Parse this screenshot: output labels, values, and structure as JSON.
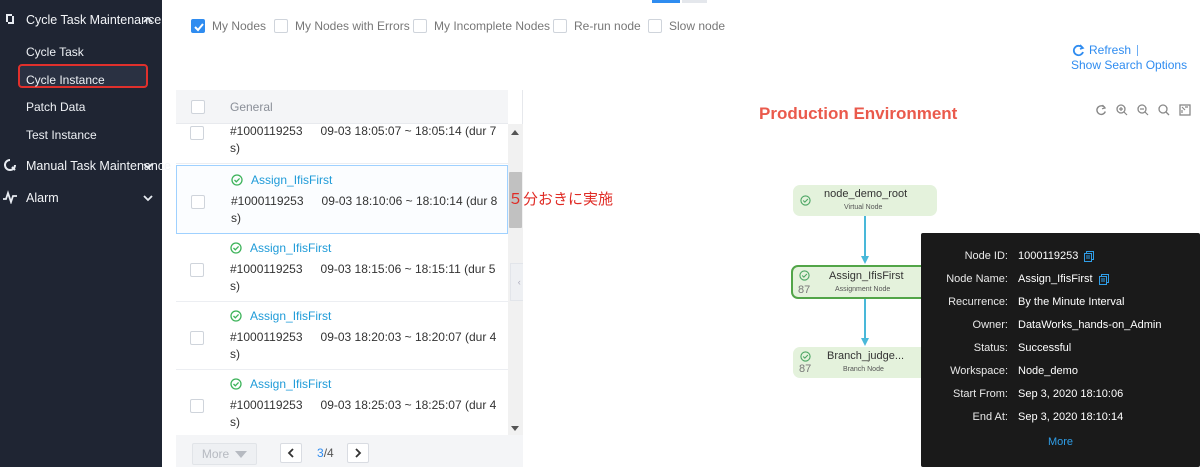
{
  "sidebar": {
    "groups": [
      {
        "label": "Cycle Task Maintenance",
        "icon": "task-cycle-icon"
      },
      {
        "label": "Manual Task Maintenance",
        "icon": "refresh-circle-icon"
      },
      {
        "label": "Alarm",
        "icon": "pulse-icon"
      }
    ],
    "items": [
      "Cycle Task",
      "Cycle Instance",
      "Patch Data",
      "Test Instance"
    ],
    "active": "Cycle Instance"
  },
  "filters": [
    {
      "label": "My Nodes",
      "checked": true
    },
    {
      "label": "My Nodes with Errors",
      "checked": false
    },
    {
      "label": "My Incomplete Nodes",
      "checked": false
    },
    {
      "label": "Re-run node",
      "checked": false
    },
    {
      "label": "Slow node",
      "checked": false
    }
  ],
  "toolbar": {
    "refresh_label": "Refresh",
    "search_options_label": "Show Search Options",
    "accent": "#2f8cf0"
  },
  "list": {
    "header": "General",
    "rows": [
      {
        "name": "",
        "id": "#1000119253",
        "time": "09-03 18:05:07 ~ 18:05:14 (dur 7",
        "tail": "s)"
      },
      {
        "name": "Assign_IfisFirst",
        "id": "#1000119253",
        "time": "09-03 18:10:06 ~ 18:10:14 (dur 8",
        "tail": "s)"
      },
      {
        "name": "Assign_IfisFirst",
        "id": "#1000119253",
        "time": "09-03 18:15:06 ~ 18:15:11 (dur 5",
        "tail": "s)"
      },
      {
        "name": "Assign_IfisFirst",
        "id": "#1000119253",
        "time": "09-03 18:20:03 ~ 18:20:07 (dur 4",
        "tail": "s)"
      },
      {
        "name": "Assign_IfisFirst",
        "id": "#1000119253",
        "time": "09-03 18:25:03 ~ 18:25:07 (dur 4",
        "tail": "s)"
      }
    ],
    "more_label": "More",
    "page_current": "3",
    "page_total": "/4"
  },
  "annotation": "５分おきに実施",
  "canvas": {
    "title": "Production Environment",
    "title_color": "#ea5a4c",
    "tools": [
      "refresh-icon",
      "zoom-in-icon",
      "zoom-out-icon",
      "search-icon",
      "fullscreen-icon"
    ],
    "nodes": [
      {
        "name": "node_demo_root",
        "type": "Virtual Node",
        "count": ""
      },
      {
        "name": "Assign_IfisFirst",
        "type": "Assignment Node",
        "count": "87"
      },
      {
        "name": "Branch_judge...",
        "type": "Branch Node",
        "count": "87"
      }
    ],
    "node_color": "#e4f2dc",
    "edge_color": "#49b8d9"
  },
  "popup": {
    "fields": [
      {
        "key": "Node ID:",
        "value": "1000119253",
        "copy": true
      },
      {
        "key": "Node Name:",
        "value": "Assign_IfisFirst",
        "copy": true
      },
      {
        "key": "Recurrence:",
        "value": "By the Minute Interval",
        "copy": false
      },
      {
        "key": "Owner:",
        "value": "DataWorks_hands-on_Admin",
        "copy": false
      },
      {
        "key": "Status:",
        "value": "Successful",
        "copy": false
      },
      {
        "key": "Workspace:",
        "value": "Node_demo",
        "copy": false
      },
      {
        "key": "Start From:",
        "value": "Sep 3, 2020 18:10:06",
        "copy": false
      },
      {
        "key": "End At:",
        "value": "Sep 3, 2020 18:10:14",
        "copy": false
      }
    ],
    "more_label": "More"
  }
}
